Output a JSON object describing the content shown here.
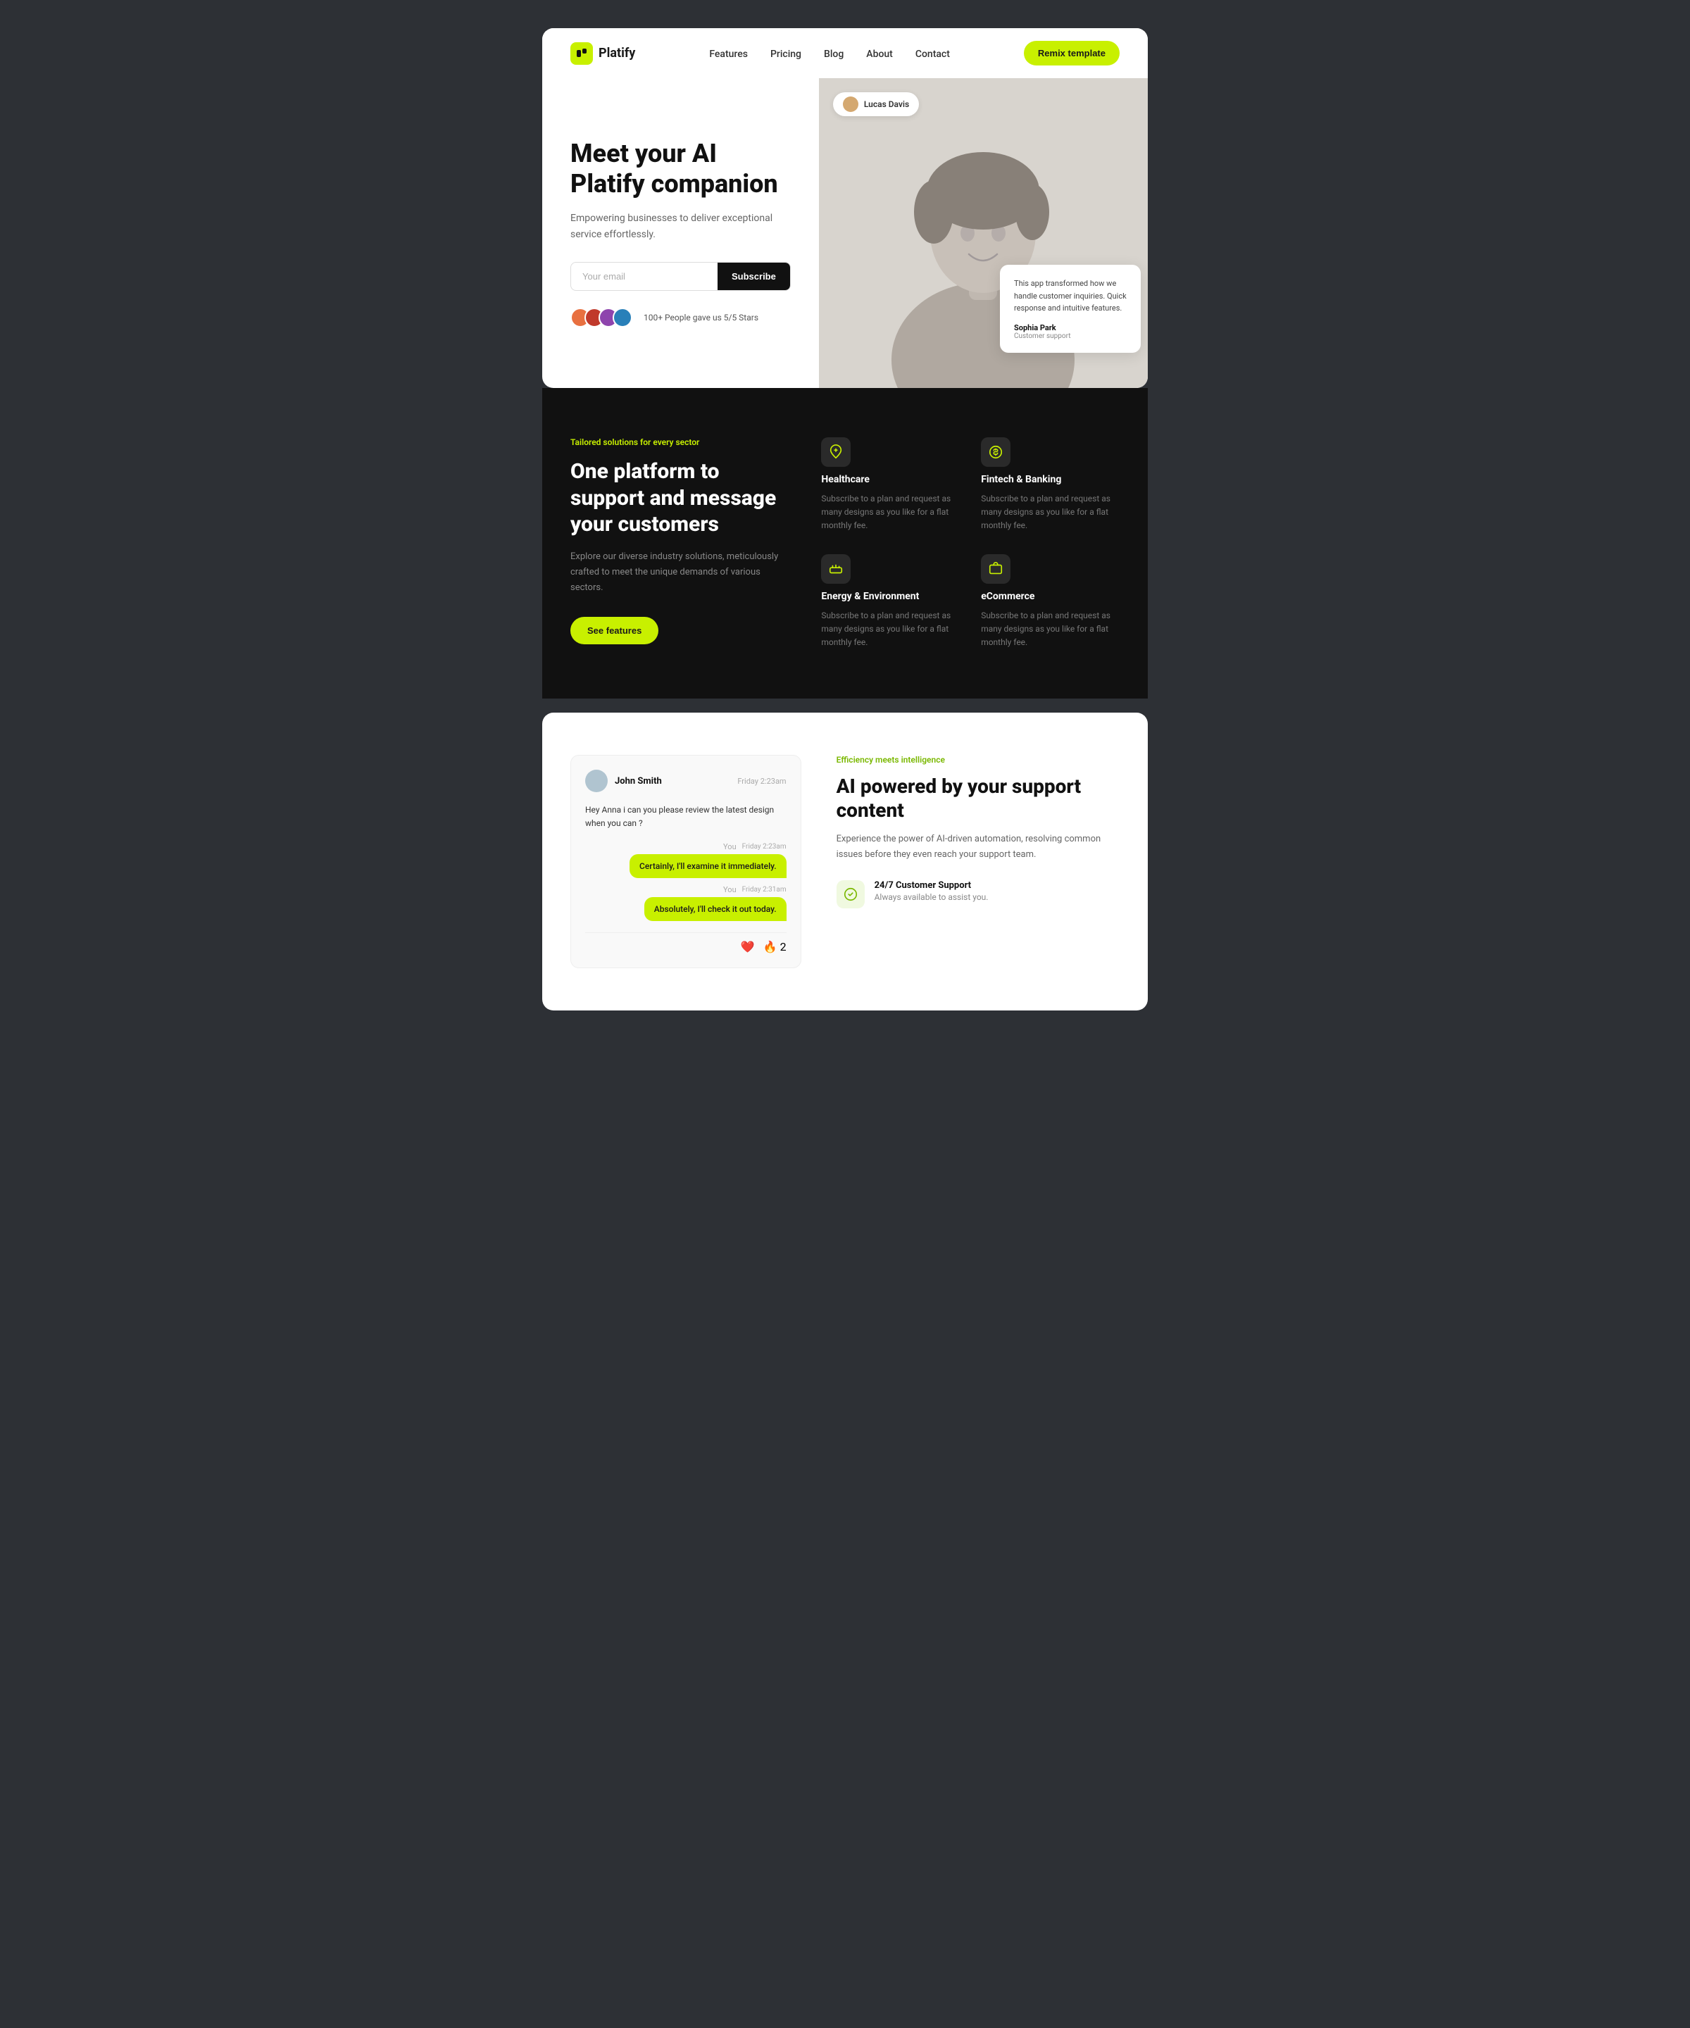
{
  "page": {
    "bg_color": "#2d3035"
  },
  "navbar": {
    "logo_text": "Platify",
    "logo_icon": "¶",
    "links": [
      {
        "label": "Features",
        "href": "#"
      },
      {
        "label": "Pricing",
        "href": "#"
      },
      {
        "label": "Blog",
        "href": "#"
      },
      {
        "label": "About",
        "href": "#"
      },
      {
        "label": "Contact",
        "href": "#"
      }
    ],
    "cta_label": "Remix template"
  },
  "hero": {
    "title": "Meet your AI Platify companion",
    "subtitle": "Empowering businesses to deliver exceptional service effortlessly.",
    "input_placeholder": "Your email",
    "subscribe_label": "Subscribe",
    "social_proof_text": "100+ People gave us 5/5 Stars",
    "user_badge": "Lucas Davis",
    "testimonial": {
      "text": "This app transformed how we handle customer inquiries. Quick response and intuitive features.",
      "author": "Sophia Park",
      "role": "Customer support"
    }
  },
  "dark_section": {
    "tag": "Tailored solutions for every sector",
    "title": "One platform to support and message your customers",
    "desc": "Explore our diverse industry solutions, meticulously crafted to meet the unique demands of various sectors.",
    "cta_label": "See features",
    "features": [
      {
        "icon": "🫀",
        "title": "Healthcare",
        "desc": "Subscribe to a plan and request as many designs as you like for a flat monthly fee."
      },
      {
        "icon": "🏦",
        "title": "Fintech & Banking",
        "desc": "Subscribe to a plan and request as many designs as you like for a flat monthly fee."
      },
      {
        "icon": "⚡",
        "title": "Energy & Environment",
        "desc": "Subscribe to a plan and request as many designs as you like for a flat monthly fee."
      },
      {
        "icon": "🛒",
        "title": "eCommerce",
        "desc": "Subscribe to a plan and request as many designs as you like for a flat monthly fee."
      }
    ]
  },
  "ai_section": {
    "tag": "Efficiency meets intelligence",
    "title": "AI powered by your support content",
    "desc": "Experience the power of AI-driven automation, resolving common issues before they even reach your support team.",
    "support_feature": {
      "icon": "🤖",
      "title": "24/7 Customer Support",
      "desc": "Always available to assist you."
    },
    "chat": {
      "user_name": "John Smith",
      "time_1": "Friday  2:23am",
      "message_incoming": "Hey Anna i can you please review the latest design when you can ?",
      "you_label": "You",
      "time_2": "Friday  2:23am",
      "bubble_1": "Certainly, I'll examine it immediately.",
      "time_3": "Friday  2:31am",
      "bubble_2": "Absolutely, I'll check it out today."
    }
  }
}
